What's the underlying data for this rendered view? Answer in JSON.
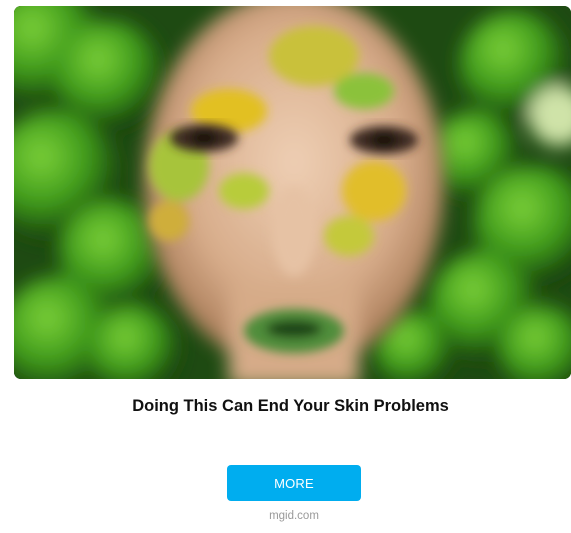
{
  "ad": {
    "image_icon": "face-photo-icon",
    "headline": "Doing This Can End Your Skin Problems",
    "button_label": "MORE",
    "source": "mgid.com"
  },
  "colors": {
    "button_bg": "#00adef",
    "lime_green": "#3f9b1b",
    "dark_green": "#1b4a0f",
    "skin": "#d9b090",
    "yellow_paint": "#e2c020"
  }
}
